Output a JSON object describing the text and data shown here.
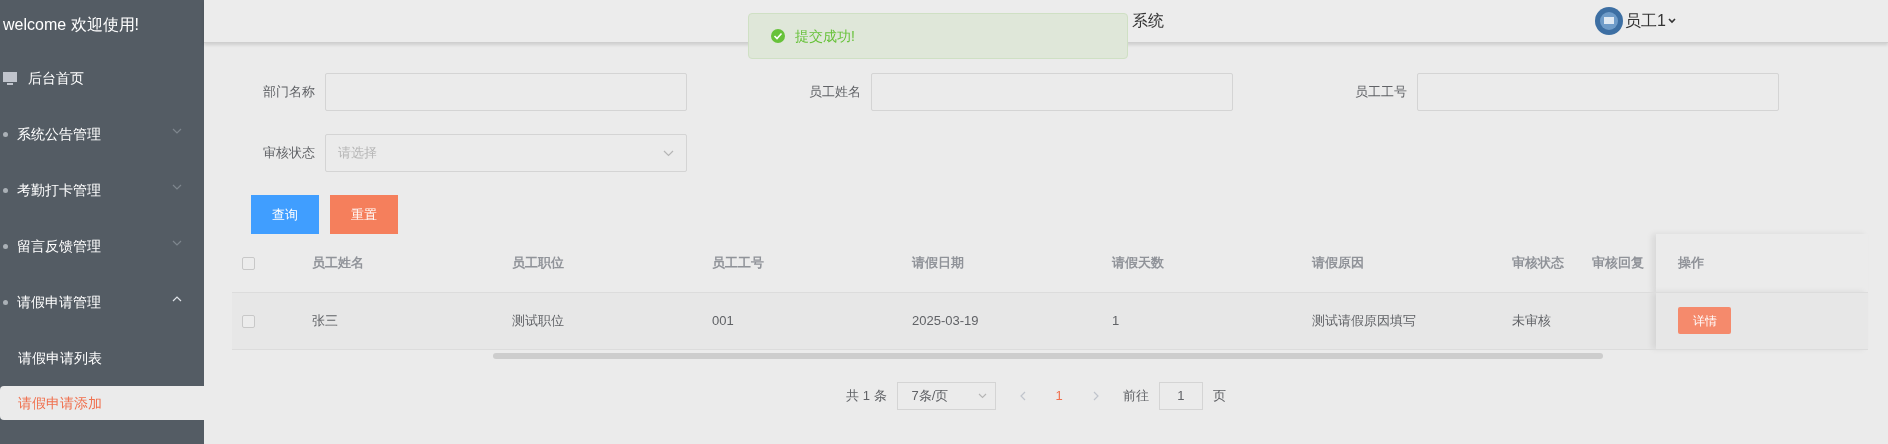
{
  "sidebar": {
    "welcome": "welcome 欢迎使用!",
    "items": [
      {
        "label": "后台首页",
        "kind": "link"
      },
      {
        "label": "系统公告管理",
        "kind": "menu",
        "expanded": false
      },
      {
        "label": "考勤打卡管理",
        "kind": "menu",
        "expanded": false
      },
      {
        "label": "留言反馈管理",
        "kind": "menu",
        "expanded": false
      },
      {
        "label": "请假申请管理",
        "kind": "menu",
        "expanded": true,
        "children": [
          {
            "label": "请假申请列表",
            "selected": false
          },
          {
            "label": "请假申请添加",
            "selected": true
          }
        ]
      }
    ]
  },
  "header": {
    "title": "系统",
    "user": "员工1"
  },
  "toast": {
    "message": "提交成功!"
  },
  "filters": [
    {
      "label": "部门名称",
      "kind": "input"
    },
    {
      "label": "员工姓名",
      "kind": "input"
    },
    {
      "label": "员工工号",
      "kind": "input"
    },
    {
      "label": "审核状态",
      "kind": "select",
      "placeholder": "请选择"
    }
  ],
  "buttons": [
    {
      "label": "查询",
      "kind": "primary"
    },
    {
      "label": "重置",
      "kind": "reset"
    }
  ],
  "table": {
    "all_checked": false,
    "columns": [
      "员工姓名",
      "员工职位",
      "员工工号",
      "请假日期",
      "请假天数",
      "请假原因",
      "审核状态",
      "审核回复",
      "操作"
    ],
    "rows": [
      {
        "checked": false,
        "cells": [
          "张三",
          "测试职位",
          "001",
          "2025-03-19",
          "1",
          "测试请假原因填写",
          "未审核"
        ],
        "action": "详情"
      }
    ]
  },
  "pagination": {
    "total": "共 1 条",
    "page_size": "7条/页",
    "pages": [
      {
        "label": "1",
        "selected": true
      }
    ],
    "goto_label": "前往",
    "goto_value": "1",
    "goto_suffix": "页"
  }
}
